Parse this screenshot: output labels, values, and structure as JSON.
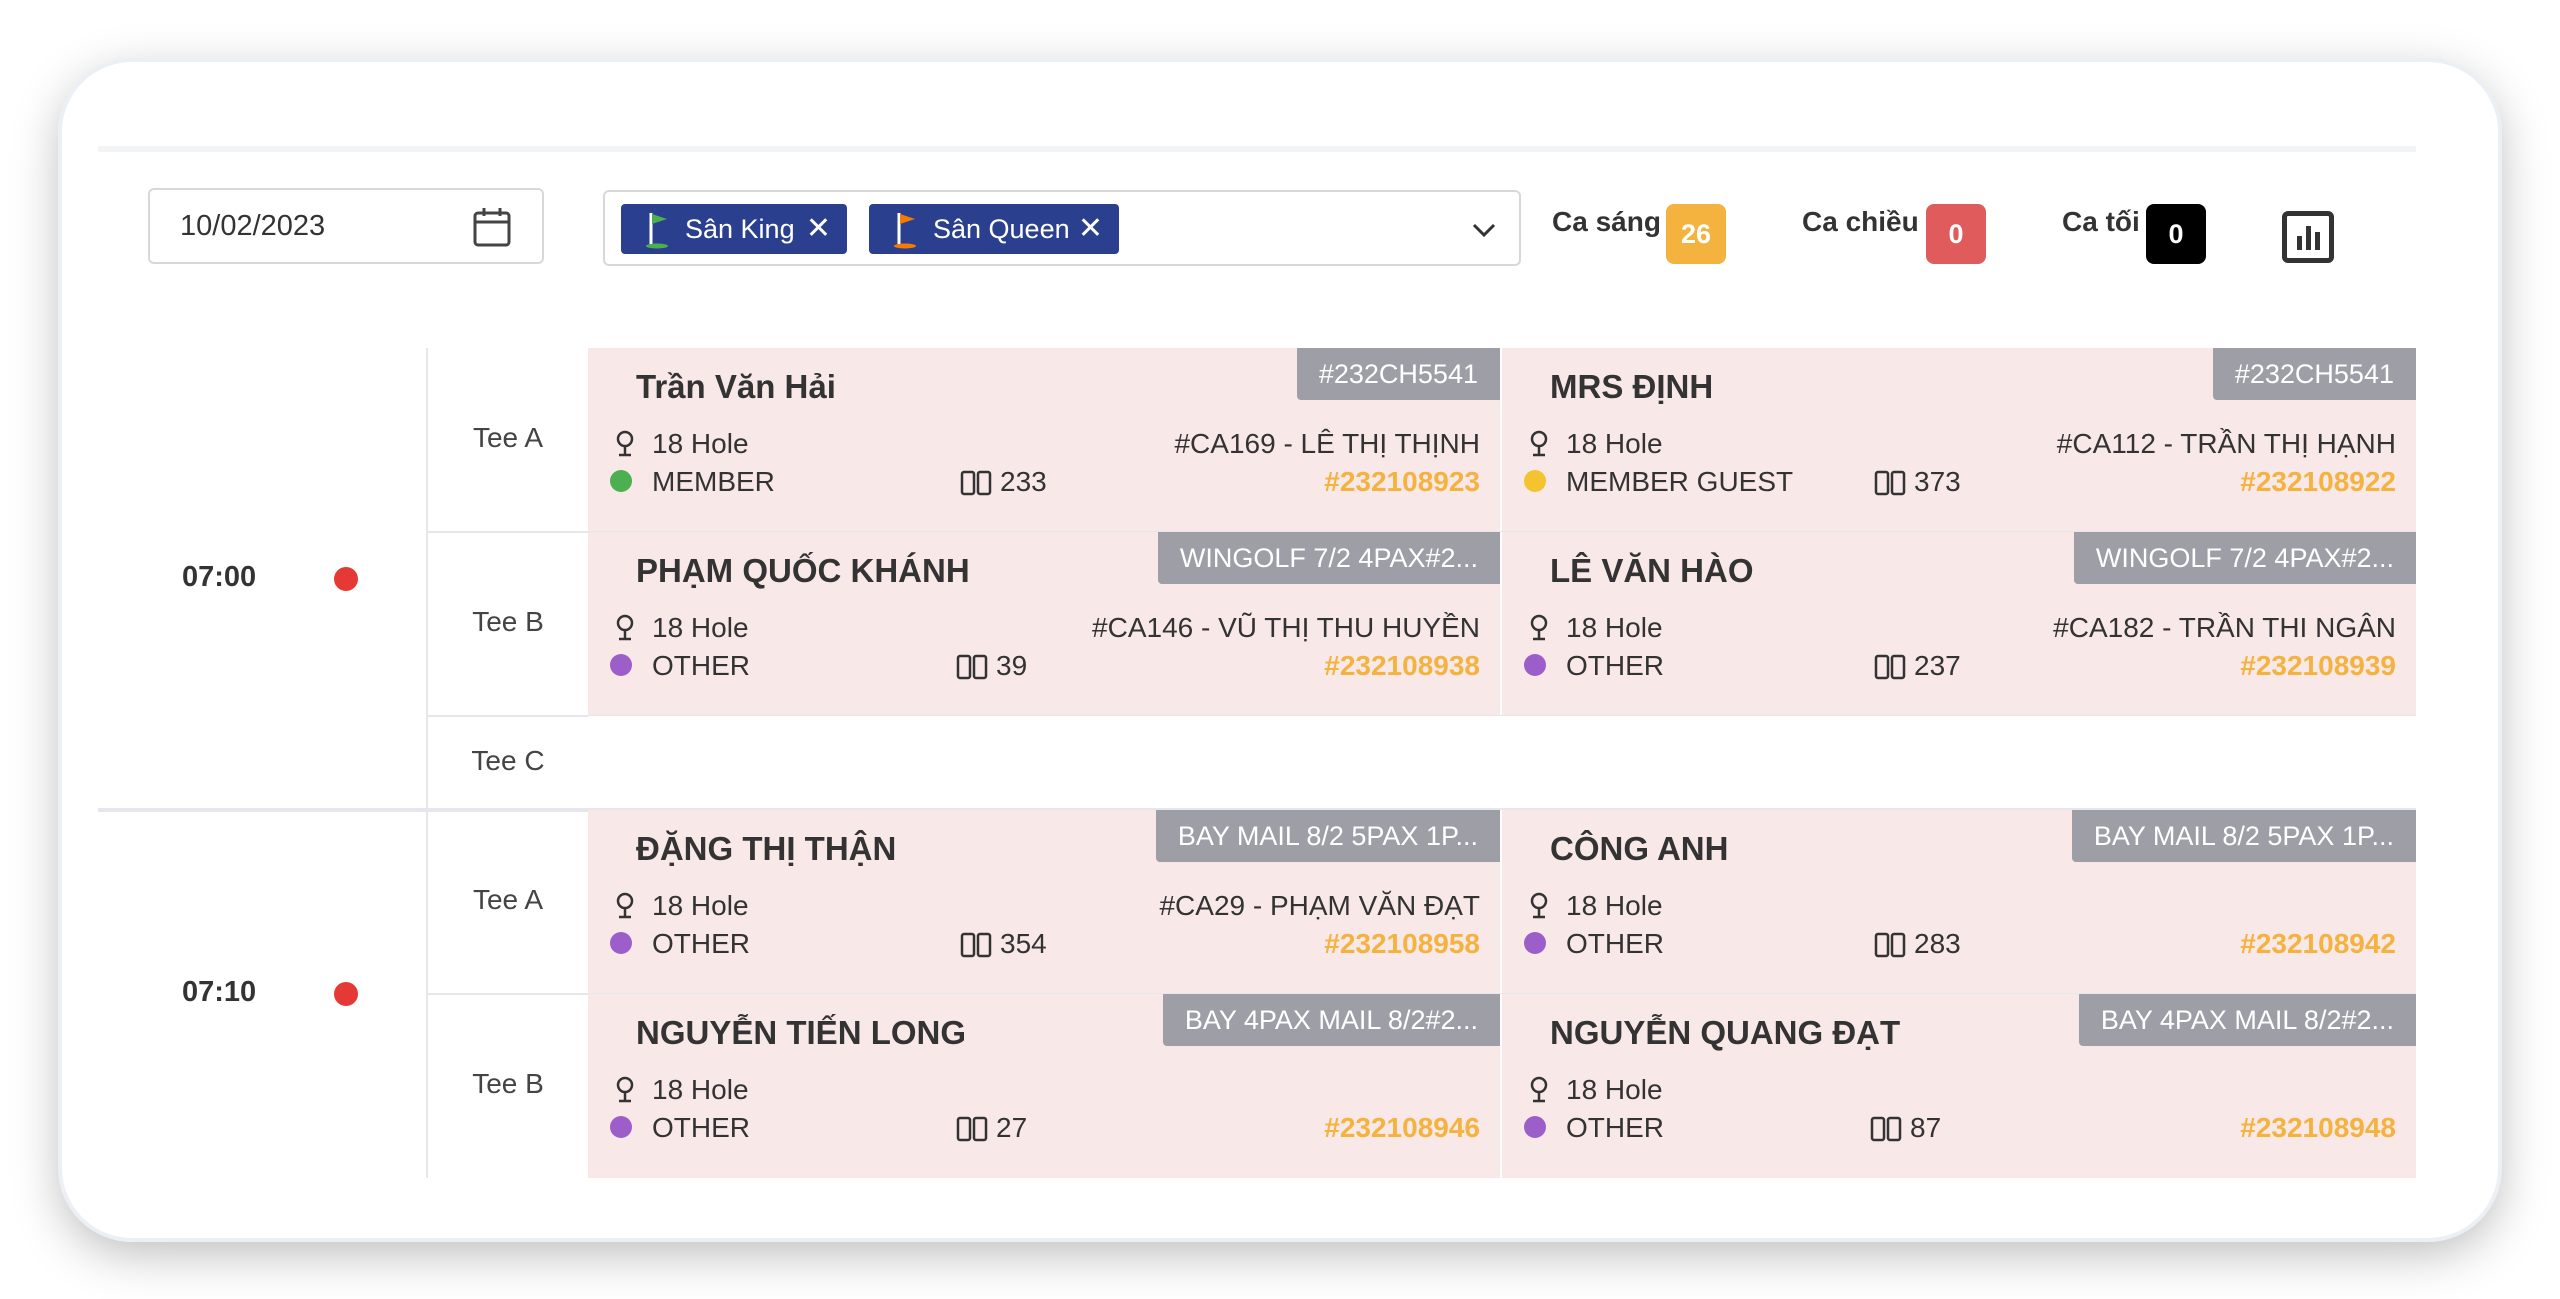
{
  "date_field": {
    "value": "10/02/2023"
  },
  "courses": {
    "chips": [
      {
        "label": "Sân King",
        "flag_color": "#4caf50"
      },
      {
        "label": "Sân Queen",
        "flag_color": "#f57c00"
      }
    ],
    "remove_symbol": "✕"
  },
  "shifts": [
    {
      "label": "Ca sáng",
      "count": "26",
      "color": "#f4b23e"
    },
    {
      "label": "Ca chiều",
      "count": "0",
      "color": "#e05b5b"
    },
    {
      "label": "Ca tối",
      "count": "0",
      "color": "#000000"
    }
  ],
  "schedule": [
    {
      "time": "07:00",
      "tees": [
        {
          "tee": "Tee A",
          "slots": [
            {
              "name": "Trần Văn Hải",
              "tag": "#232CH5541",
              "hole": "18 Hole",
              "type": "MEMBER",
              "type_color": "#4caf50",
              "bag": "233",
              "caddie": "#CA169 - LÊ THỊ THỊNH",
              "booking": "#232108923"
            },
            {
              "name": "MRS ĐỊNH",
              "tag": "#232CH5541",
              "hole": "18 Hole",
              "type": "MEMBER GUEST",
              "type_color": "#f4c430",
              "bag": "373",
              "caddie": "#CA112 - TRẦN THỊ HẠNH",
              "booking": "#232108922"
            }
          ]
        },
        {
          "tee": "Tee B",
          "slots": [
            {
              "name": "PHẠM QUỐC KHÁNH",
              "tag": "WINGOLF 7/2 4PAX#2...",
              "hole": "18 Hole",
              "type": "OTHER",
              "type_color": "#9c5fc9",
              "bag": "39",
              "caddie": "#CA146 - VŨ THỊ THU HUYỀN",
              "booking": "#232108938"
            },
            {
              "name": "LÊ VĂN HÀO",
              "tag": "WINGOLF 7/2 4PAX#2...",
              "hole": "18 Hole",
              "type": "OTHER",
              "type_color": "#9c5fc9",
              "bag": "237",
              "caddie": "#CA182 - TRẦN THI NGÂN",
              "booking": "#232108939"
            }
          ]
        },
        {
          "tee": "Tee C",
          "slots": []
        }
      ]
    },
    {
      "time": "07:10",
      "tees": [
        {
          "tee": "Tee A",
          "slots": [
            {
              "name": "ĐẶNG THỊ THẬN",
              "tag": "BAY MAIL 8/2 5PAX 1P...",
              "hole": "18 Hole",
              "type": "OTHER",
              "type_color": "#9c5fc9",
              "bag": "354",
              "caddie": "#CA29 - PHẠM VĂN ĐẠT",
              "booking": "#232108958"
            },
            {
              "name": "CÔNG ANH",
              "tag": "BAY MAIL 8/2 5PAX 1P...",
              "hole": "18 Hole",
              "type": "OTHER",
              "type_color": "#9c5fc9",
              "bag": "283",
              "caddie": "",
              "booking": "#232108942"
            }
          ]
        },
        {
          "tee": "Tee B",
          "slots": [
            {
              "name": "NGUYỄN TIẾN LONG",
              "tag": "BAY 4PAX MAIL 8/2#2...",
              "hole": "18 Hole",
              "type": "OTHER",
              "type_color": "#9c5fc9",
              "bag": "27",
              "caddie": "",
              "booking": "#232108946"
            },
            {
              "name": "NGUYỄN QUANG ĐẠT",
              "tag": "BAY 4PAX MAIL 8/2#2...",
              "hole": "18 Hole",
              "type": "OTHER",
              "type_color": "#9c5fc9",
              "bag": "87",
              "caddie": "",
              "booking": "#232108948"
            }
          ]
        }
      ]
    }
  ]
}
